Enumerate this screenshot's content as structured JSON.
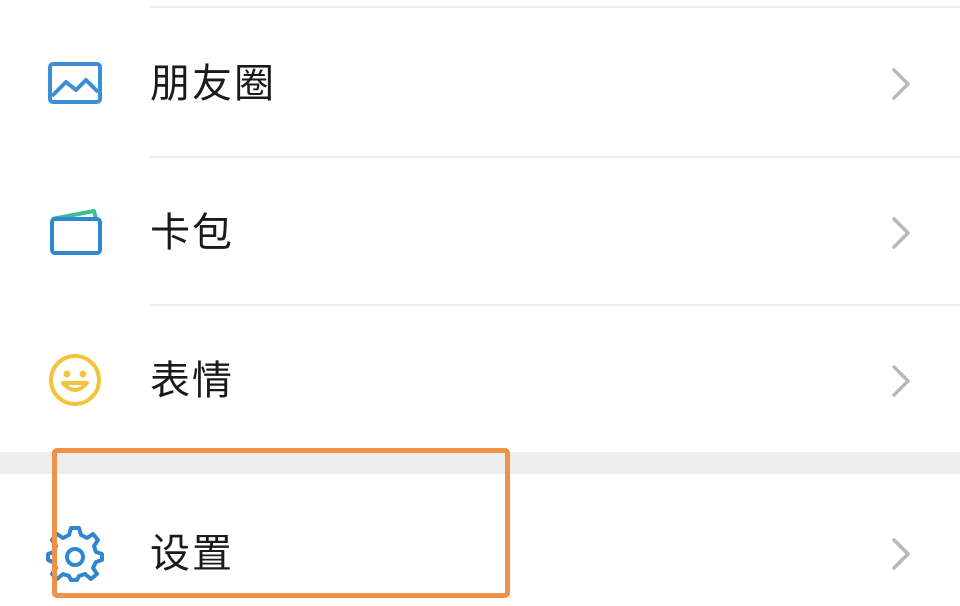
{
  "menu": {
    "items": [
      {
        "label": "朋友圈",
        "icon": "moments-picture-icon"
      },
      {
        "label": "卡包",
        "icon": "card-wallet-icon"
      },
      {
        "label": "表情",
        "icon": "smiley-face-icon"
      },
      {
        "label": "设置",
        "icon": "gear-icon"
      }
    ]
  },
  "colors": {
    "moments_icon": "#3b8fd6",
    "wallet_icon_blue": "#2f86d1",
    "wallet_icon_green": "#3cbf8e",
    "smiley_icon": "#f2c43a",
    "settings_icon": "#2f86d1",
    "highlight": "#f0914a",
    "chevron": "#b8b8b8",
    "section_gap": "#ededed"
  }
}
